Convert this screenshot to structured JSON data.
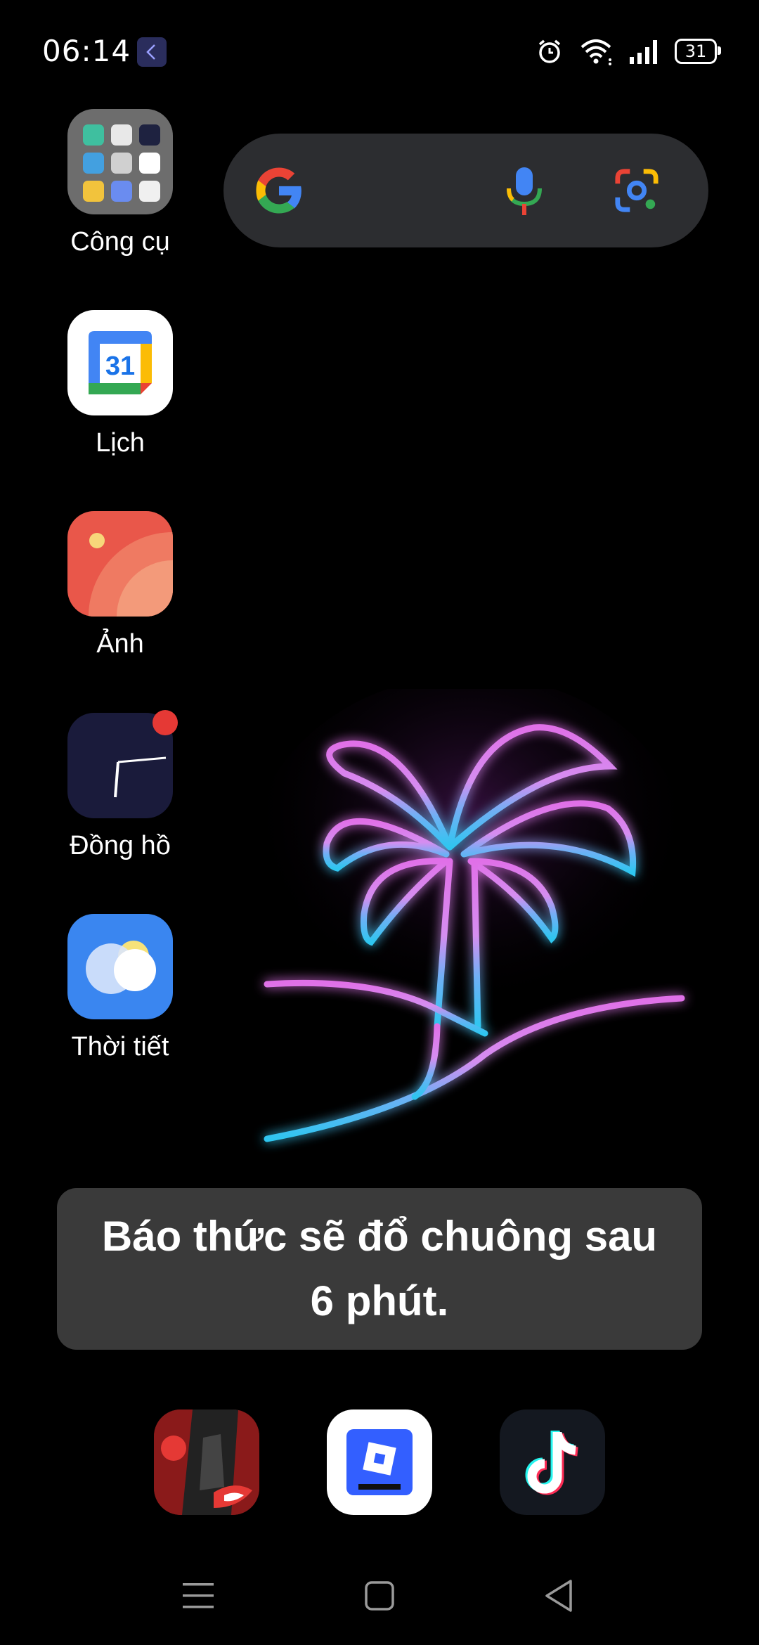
{
  "status_bar": {
    "time": "06:14",
    "battery_level": "31",
    "icons": [
      "alarm-icon",
      "wifi-icon",
      "signal-icon",
      "battery-icon"
    ]
  },
  "search_bar": {
    "icons": [
      "google-logo-icon",
      "microphone-icon",
      "google-lens-icon"
    ]
  },
  "apps": [
    {
      "label": "Công cụ",
      "icon": "tools-folder-icon"
    },
    {
      "label": "Lịch",
      "icon": "calendar-icon",
      "icon_text": "31"
    },
    {
      "label": "Ảnh",
      "icon": "photos-icon"
    },
    {
      "label": "Đồng hồ",
      "icon": "clock-icon",
      "badge": true
    },
    {
      "label": "Thời tiết",
      "icon": "weather-icon"
    }
  ],
  "toast": {
    "message": "Báo thức sẽ đổ chuông sau 6 phút."
  },
  "dock": [
    "free-fire-game-icon",
    "roblox-icon",
    "tiktok-icon"
  ],
  "nav_bar": [
    "menu-recents-icon",
    "home-icon",
    "back-icon"
  ],
  "colors": {
    "background": "#000000",
    "search_bg": "#2c2d30",
    "toast_bg": "#3a3a3a",
    "badge": "#e53935",
    "wallpaper_pink": "#e070e8",
    "wallpaper_cyan": "#2fc6f0"
  }
}
